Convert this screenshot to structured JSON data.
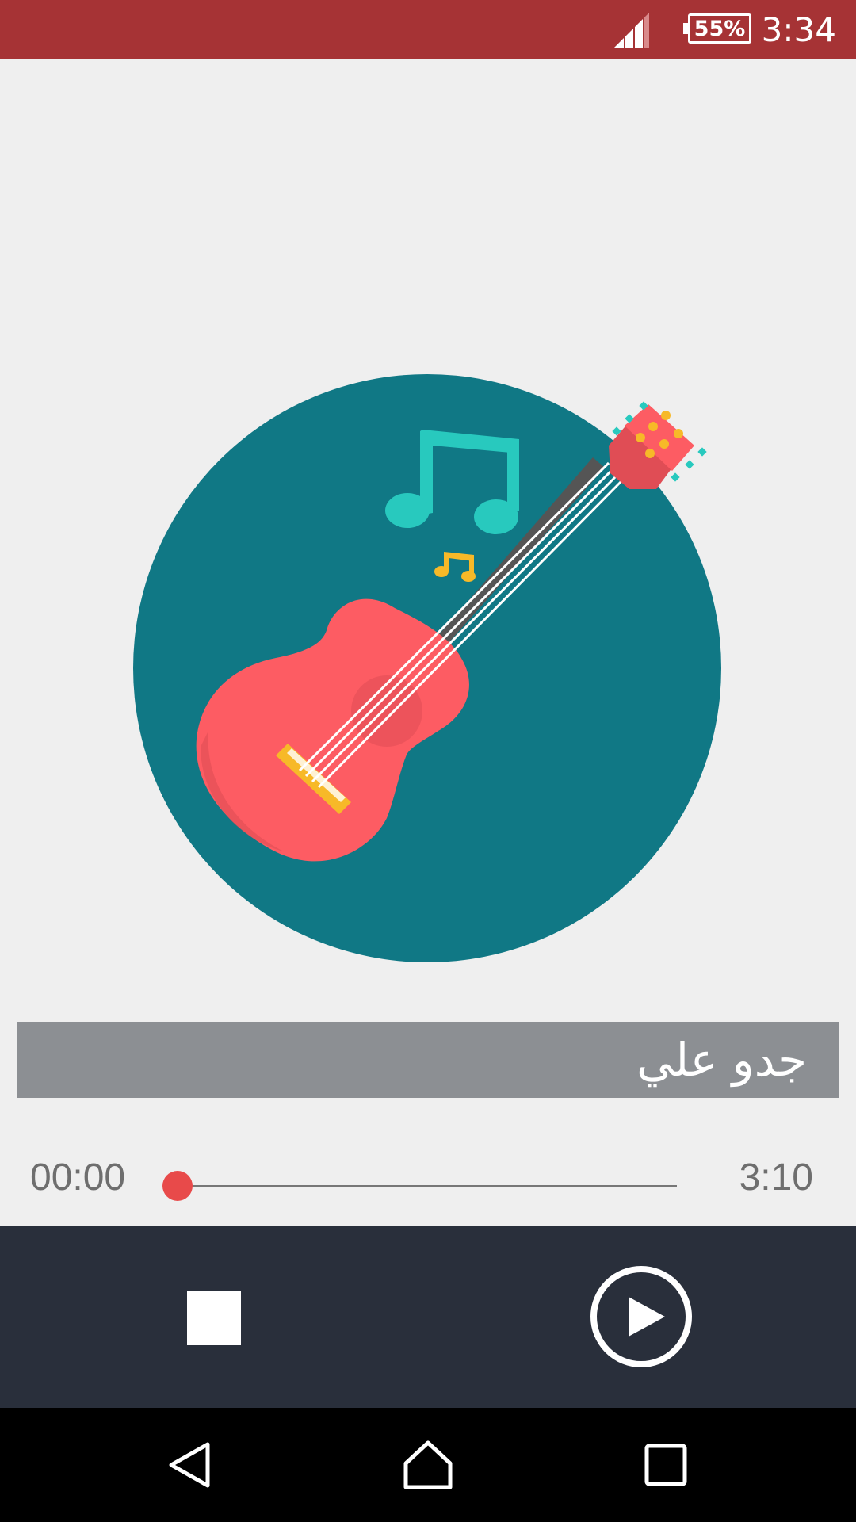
{
  "status_bar": {
    "battery_percent": "55%",
    "time": "3:34",
    "icons": [
      "signal-icon",
      "battery-icon"
    ]
  },
  "album_art": {
    "description_icon": "guitar-icon",
    "colors": {
      "circle": "#107885",
      "guitar_body": "#fd5c63",
      "note_large": "#28c9be",
      "note_small": "#f7b928"
    }
  },
  "track": {
    "title": "جدو علي"
  },
  "player": {
    "current_time": "00:00",
    "total_time": "3:10",
    "progress": 0
  },
  "controls": {
    "stop_icon": "stop-icon",
    "play_icon": "play-icon"
  },
  "nav_bar": {
    "icons": [
      "back-icon",
      "home-icon",
      "recent-apps-icon"
    ]
  },
  "colors": {
    "status_bar": "#a63335",
    "title_bar": "#8c8f93",
    "controls_bg": "#292f3b",
    "seek_thumb": "#e84a4a"
  }
}
